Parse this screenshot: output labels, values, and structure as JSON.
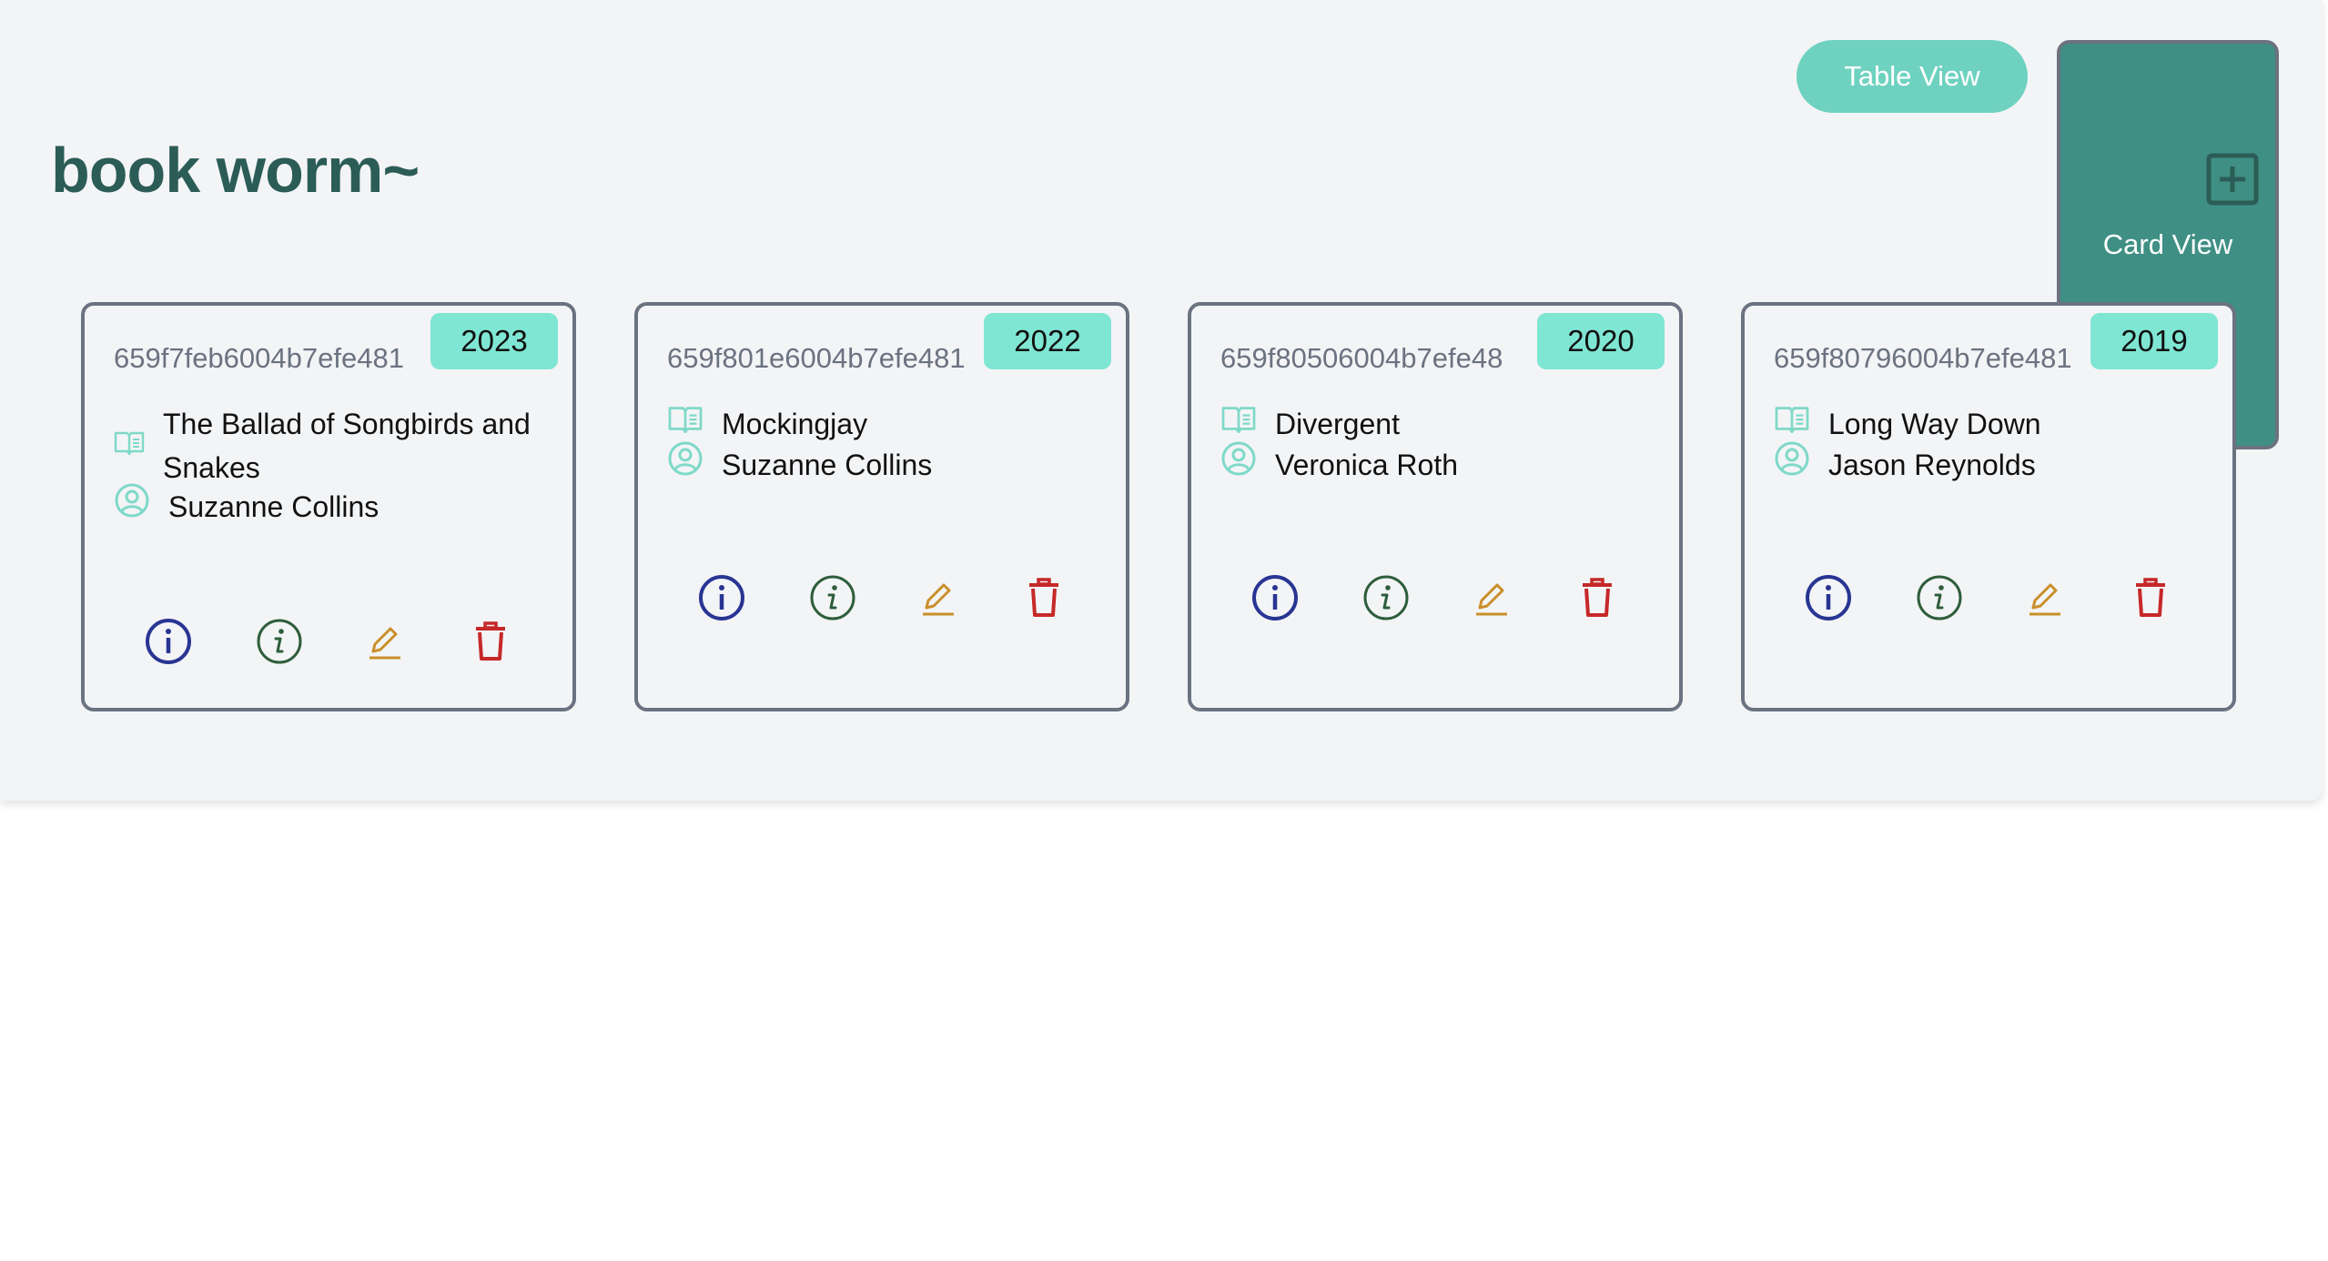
{
  "header": {
    "table_view_label": "Table View",
    "card_view_label": "Card View",
    "app_title": "book worm~"
  },
  "books": [
    {
      "id": "659f7feb6004b7efe481",
      "year": "2023",
      "title": "The Ballad of Songbirds and Snakes",
      "author": "Suzanne Collins"
    },
    {
      "id": "659f801e6004b7efe481",
      "year": "2022",
      "title": "Mockingjay",
      "author": "Suzanne Collins"
    },
    {
      "id": "659f80506004b7efe48",
      "year": "2020",
      "title": "Divergent",
      "author": "Veronica Roth"
    },
    {
      "id": "659f80796004b7efe481",
      "year": "2019",
      "title": "Long Way Down",
      "author": "Jason Reynolds"
    }
  ],
  "icons": {
    "add": "plus-square-icon",
    "title": "book-open-icon",
    "author": "user-circle-icon",
    "action1": "info-circle-icon",
    "action2": "info-italic-icon",
    "action3": "pencil-icon",
    "action4": "trash-icon"
  },
  "colors": {
    "panel_bg": "#f3f4f6",
    "title": "#2b5c56",
    "table_btn": "#6fd2c0",
    "card_btn": "#3f8f84",
    "badge": "#7fe6d4",
    "card_border": "#6b7280",
    "info_blue": "#283593",
    "info_green": "#2e5e3c",
    "edit": "#c98f2a",
    "delete": "#c62828",
    "icon_teal": "#7fd9c8"
  }
}
